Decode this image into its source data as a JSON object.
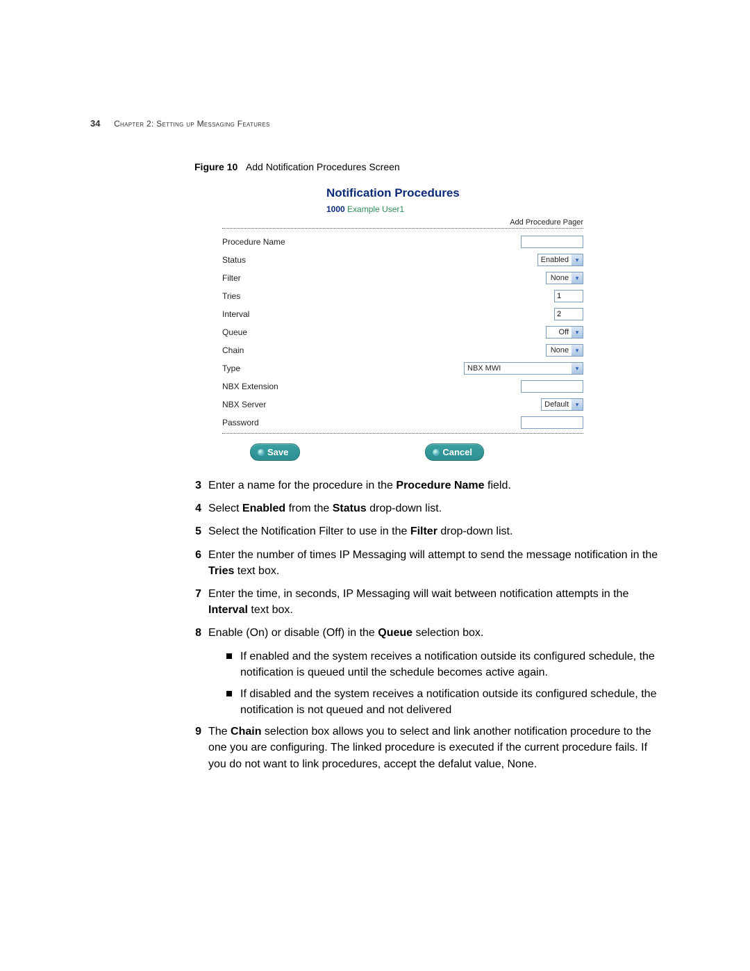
{
  "header": {
    "page_number": "34",
    "chapter_line": "Chapter 2: Setting up Messaging Features"
  },
  "figure": {
    "label": "Figure 10",
    "caption": "Add Notification Procedures Screen"
  },
  "screenshot": {
    "title": "Notification Procedures",
    "user_ext": "1000",
    "user_name": "Example User1",
    "add_link": "Add Procedure Pager",
    "rows": {
      "procedure_name_label": "Procedure Name",
      "procedure_name_value": "",
      "status_label": "Status",
      "status_value": "Enabled",
      "filter_label": "Filter",
      "filter_value": "None",
      "tries_label": "Tries",
      "tries_value": "1",
      "interval_label": "Interval",
      "interval_value": "2",
      "queue_label": "Queue",
      "queue_value": "Off",
      "chain_label": "Chain",
      "chain_value": "None",
      "type_label": "Type",
      "type_value": "NBX MWI",
      "nbx_ext_label": "NBX Extension",
      "nbx_ext_value": "",
      "nbx_server_label": "NBX Server",
      "nbx_server_value": "Default",
      "password_label": "Password",
      "password_value": ""
    },
    "buttons": {
      "save": "Save",
      "cancel": "Cancel"
    }
  },
  "steps": {
    "s3": {
      "n": "3",
      "pre": "Enter a name for the procedure in the ",
      "bold": "Procedure Name",
      "post": " field."
    },
    "s4": {
      "n": "4",
      "t1": "Select ",
      "b1": "Enabled",
      "t2": " from the ",
      "b2": "Status",
      "t3": " drop-down list."
    },
    "s5": {
      "n": "5",
      "t1": "Select the Notification Filter to use in the ",
      "b1": "Filter",
      "t2": " drop-down list."
    },
    "s6": {
      "n": "6",
      "t1": "Enter the number of times IP Messaging will attempt to send the message notification in the ",
      "b1": "Tries",
      "t2": " text box."
    },
    "s7": {
      "n": "7",
      "t1": "Enter the time, in seconds, IP Messaging will wait between notification attempts in the ",
      "b1": "Interval",
      "t2": " text box."
    },
    "s8": {
      "n": "8",
      "t1": "Enable (On) or disable (Off) in the ",
      "b1": "Queue",
      "t2": " selection box."
    },
    "s8a": "If enabled and the system receives a notification outside its configured schedule, the notification is queued until the schedule becomes active again.",
    "s8b": "If disabled and the system receives a notification outside its configured schedule, the notification is not queued and not delivered",
    "s9": {
      "n": "9",
      "t1": "The ",
      "b1": "Chain",
      "t2": " selection box allows you to select and link another notification procedure to the one you are configuring. The linked procedure is executed if the current procedure fails. If you do not want to link procedures, accept the defalut value, None."
    }
  }
}
